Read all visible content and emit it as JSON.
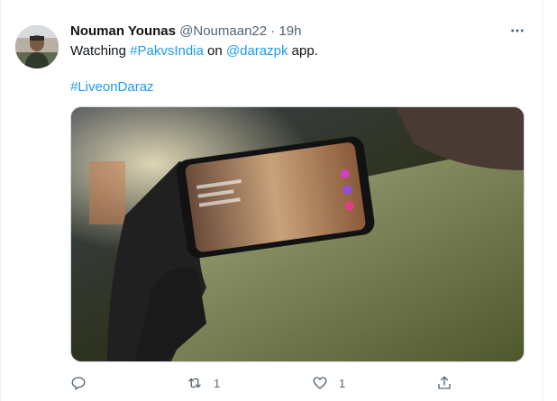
{
  "tweet": {
    "author_name": "Nouman Younas",
    "handle": "@Noumaan22",
    "separator": "·",
    "time": "19h",
    "text_before": "Watching ",
    "hashtag1": "#PakvsIndia",
    "text_mid": " on ",
    "mention": "@darazpk",
    "text_after": " app.",
    "hashtag2": "#LiveonDaraz",
    "more_icon": "more-horizontal-icon"
  },
  "actions": {
    "reply_count": "",
    "retweet_count": "1",
    "like_count": "1",
    "share_count": ""
  },
  "colors": {
    "link": "#1d9bf0",
    "muted": "#536471",
    "text": "#0f1419",
    "border": "#eff3f4"
  }
}
